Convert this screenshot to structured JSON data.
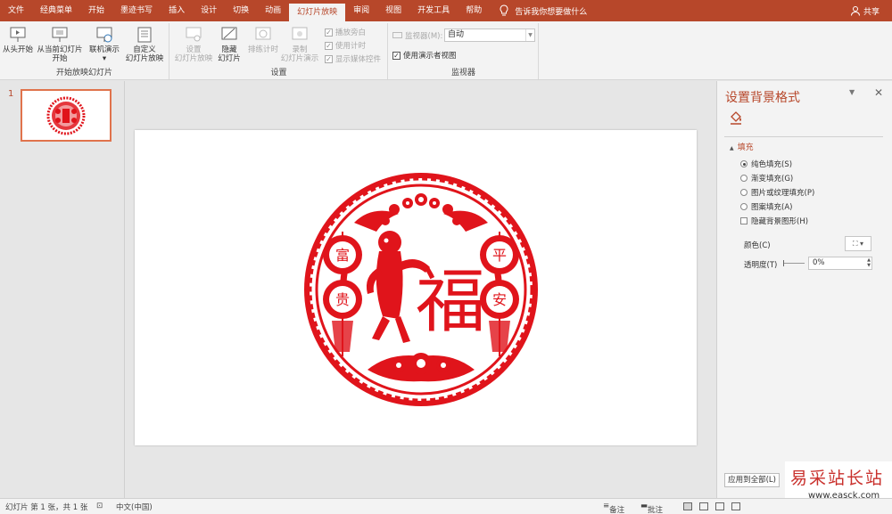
{
  "tabs": [
    "文件",
    "经典菜单",
    "开始",
    "墨迹书写",
    "插入",
    "设计",
    "切换",
    "动画",
    "幻灯片放映",
    "审阅",
    "视图",
    "开发工具",
    "帮助"
  ],
  "active_tab": "幻灯片放映",
  "tell_me": "告诉我你想要做什么",
  "share": "共享",
  "ribbon": {
    "from_start": "从头开始",
    "from_current_1": "从当前幻灯片",
    "from_current_2": "开始",
    "online_present": "联机演示",
    "custom_1": "自定义",
    "custom_2": "幻灯片放映",
    "group_start": "开始放映幻灯片",
    "setup_1": "设置",
    "setup_2": "幻灯片放映",
    "hide_1": "隐藏",
    "hide_2": "幻灯片",
    "rehearse": "排练计时",
    "record_1": "录制",
    "record_2": "幻灯片演示",
    "play_narrations": "播放旁白",
    "use_timings": "使用计时",
    "show_media_controls": "显示媒体控件",
    "group_setup": "设置",
    "monitor_label": "监视器(M):",
    "monitor_value": "自动",
    "presenter_view": "使用演示者视图",
    "group_monitors": "监视器"
  },
  "thumbnail": {
    "number": "1"
  },
  "slide_art": {
    "top_left_char": "富",
    "bottom_left_char": "贵",
    "top_right_char": "平",
    "bottom_right_char": "安",
    "center_char": "福",
    "color": "#e0141b"
  },
  "format_pane": {
    "title": "设置背景格式",
    "section": "填充",
    "options": [
      "纯色填充(S)",
      "渐变填充(G)",
      "图片或纹理填充(P)",
      "图案填充(A)"
    ],
    "selected_option": 0,
    "hide_graphics": "隐藏背景图形(H)",
    "color_label": "颜色(C)",
    "transparency_label": "透明度(T)",
    "transparency_value": "0%",
    "apply_all": "应用到全部(L)"
  },
  "watermark": {
    "big": "易采站长站",
    "small": "www.easck.com"
  },
  "status": {
    "slide_info": "幻灯片 第 1 张，共 1 张",
    "language": "中文(中国)",
    "notes": "备注",
    "comments": "批注"
  }
}
